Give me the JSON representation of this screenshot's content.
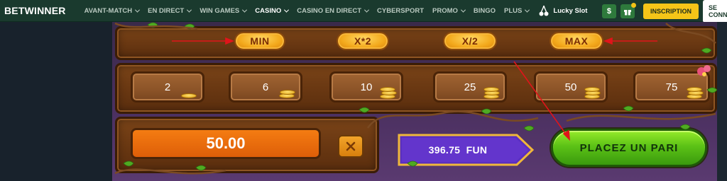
{
  "nav": {
    "logo": "BETWINNER",
    "items": [
      {
        "label": "AVANT-MATCH",
        "dropdown": true,
        "active": false
      },
      {
        "label": "EN DIRECT",
        "dropdown": true,
        "active": false
      },
      {
        "label": "WIN GAMES",
        "dropdown": true,
        "active": false
      },
      {
        "label": "CASINO",
        "dropdown": true,
        "active": true
      },
      {
        "label": "CASINO EN DIRECT",
        "dropdown": true,
        "active": false
      },
      {
        "label": "CYBERSPORT",
        "dropdown": false,
        "active": false
      },
      {
        "label": "PROMO",
        "dropdown": true,
        "active": false
      },
      {
        "label": "BINGO",
        "dropdown": false,
        "active": false
      },
      {
        "label": "PLUS",
        "dropdown": true,
        "active": false
      }
    ],
    "lucky_slot": "Lucky Slot",
    "dollar_icon": "$",
    "register_label": "INSCRIPTION",
    "login_label": "SE CONNECTER"
  },
  "game": {
    "multipliers": [
      "MIN",
      "X*2",
      "X/2",
      "MAX"
    ],
    "chips": [
      "2",
      "6",
      "10",
      "25",
      "50",
      "75"
    ],
    "bet_amount": "50.00",
    "balance": "396.75",
    "currency": "FUN",
    "place_bet_label": "PLACEZ UN PARI"
  },
  "colors": {
    "nav_bg": "#1a3a2e",
    "accent_yellow": "#f5c518",
    "annotation_arrow": "#e0141a",
    "bet_green": "#5cc216",
    "amount_orange": "#f47c12",
    "balance_purple": "#5a2fc0"
  },
  "icons": {
    "cherry": "cherry-icon",
    "dollar": "dollar-icon",
    "gift": "gift-icon",
    "close": "close-icon",
    "coins": "coin-stack-icon",
    "arrow": "annotation-arrow"
  }
}
